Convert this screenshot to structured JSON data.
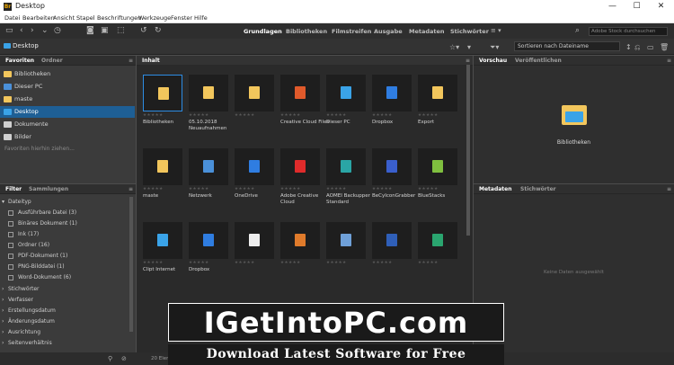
{
  "window": {
    "title": "Desktop",
    "minimize": "—",
    "maximize": "☐",
    "close": "✕"
  },
  "menu": [
    "Datei",
    "Bearbeiten",
    "Ansicht",
    "Stapel",
    "Beschriftungen",
    "Werkzeuge",
    "Fenster",
    "Hilfe"
  ],
  "workspaces": [
    "Grundlagen",
    "Bibliotheken",
    "Filmstreifen",
    "Ausgabe",
    "Metadaten",
    "Stichwörter"
  ],
  "search": {
    "placeholder": "Adobe Stock durchsuchen"
  },
  "path": {
    "crumb": "Desktop"
  },
  "sort": {
    "label": "Sortieren nach Dateiname"
  },
  "left": {
    "tabs": [
      "Favoriten",
      "Ordner"
    ],
    "favorites": [
      {
        "label": "Bibliotheken",
        "color": "#f2c65c"
      },
      {
        "label": "Dieser PC",
        "color": "#4a90d9"
      },
      {
        "label": "maste",
        "color": "#f2c65c"
      },
      {
        "label": "Desktop",
        "color": "#3aa3e8"
      },
      {
        "label": "Dokumente",
        "color": "#d0d0d0"
      },
      {
        "label": "Bilder",
        "color": "#d0d0d0"
      }
    ],
    "drop_hint": "Favoriten hierhin ziehen...",
    "filter_tabs": [
      "Filter",
      "Sammlungen"
    ],
    "filter_group": "Dateityp",
    "filter_items": [
      "Ausführbare Datei (3)",
      "Binäres Dokument (1)",
      "Ink (17)",
      "Ordner (16)",
      "PDF-Dokument (1)",
      "PNG-Bilddatei (1)",
      "Word-Dokument (6)"
    ],
    "filter_sections": [
      "Stichwörter",
      "Verfasser",
      "Erstellungsdatum",
      "Änderungsdatum",
      "Ausrichtung",
      "Seitenverhältnis"
    ]
  },
  "content": {
    "tab": "Inhalt",
    "items": [
      {
        "label": "Bibliotheken"
      },
      {
        "label": "05.10.2018 Neuaufnahmen"
      },
      {
        "label": ""
      },
      {
        "label": "Creative Cloud Files"
      },
      {
        "label": "Dieser PC"
      },
      {
        "label": "Dropbox"
      },
      {
        "label": "Export"
      },
      {
        "label": "maste"
      },
      {
        "label": "Netzwerk"
      },
      {
        "label": "OneDrive"
      },
      {
        "label": "Adobe Creative Cloud"
      },
      {
        "label": "AOMEI Backupper Standard"
      },
      {
        "label": "BeCyIconGrabber"
      },
      {
        "label": "BlueStacks"
      },
      {
        "label": "Clipt Internet"
      },
      {
        "label": "Dropbox"
      },
      {
        "label": ""
      },
      {
        "label": ""
      },
      {
        "label": ""
      },
      {
        "label": ""
      },
      {
        "label": ""
      }
    ]
  },
  "right": {
    "tabs": [
      "Vorschau",
      "Veröffentlichen"
    ],
    "preview_label": "Bibliotheken",
    "meta_tabs": [
      "Metadaten",
      "Stichwörter"
    ],
    "meta_empty": "Keine Daten ausgewählt"
  },
  "status": {
    "count": "20 Elemente"
  },
  "watermark": {
    "line1": "IGetIntoPC.com",
    "line2": "Download Latest Software for Free"
  }
}
